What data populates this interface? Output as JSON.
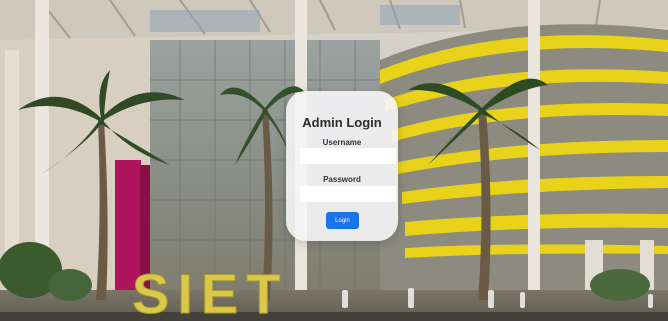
{
  "login": {
    "title": "Admin Login",
    "username_label": "Username",
    "username_value": "",
    "password_label": "Password",
    "password_value": "",
    "button_label": "Login"
  },
  "background": {
    "sign_text": "SIET"
  },
  "colors": {
    "button": "#1a73e8",
    "stripe_yellow": "#e8d21a",
    "accent_magenta": "#b0145e"
  }
}
